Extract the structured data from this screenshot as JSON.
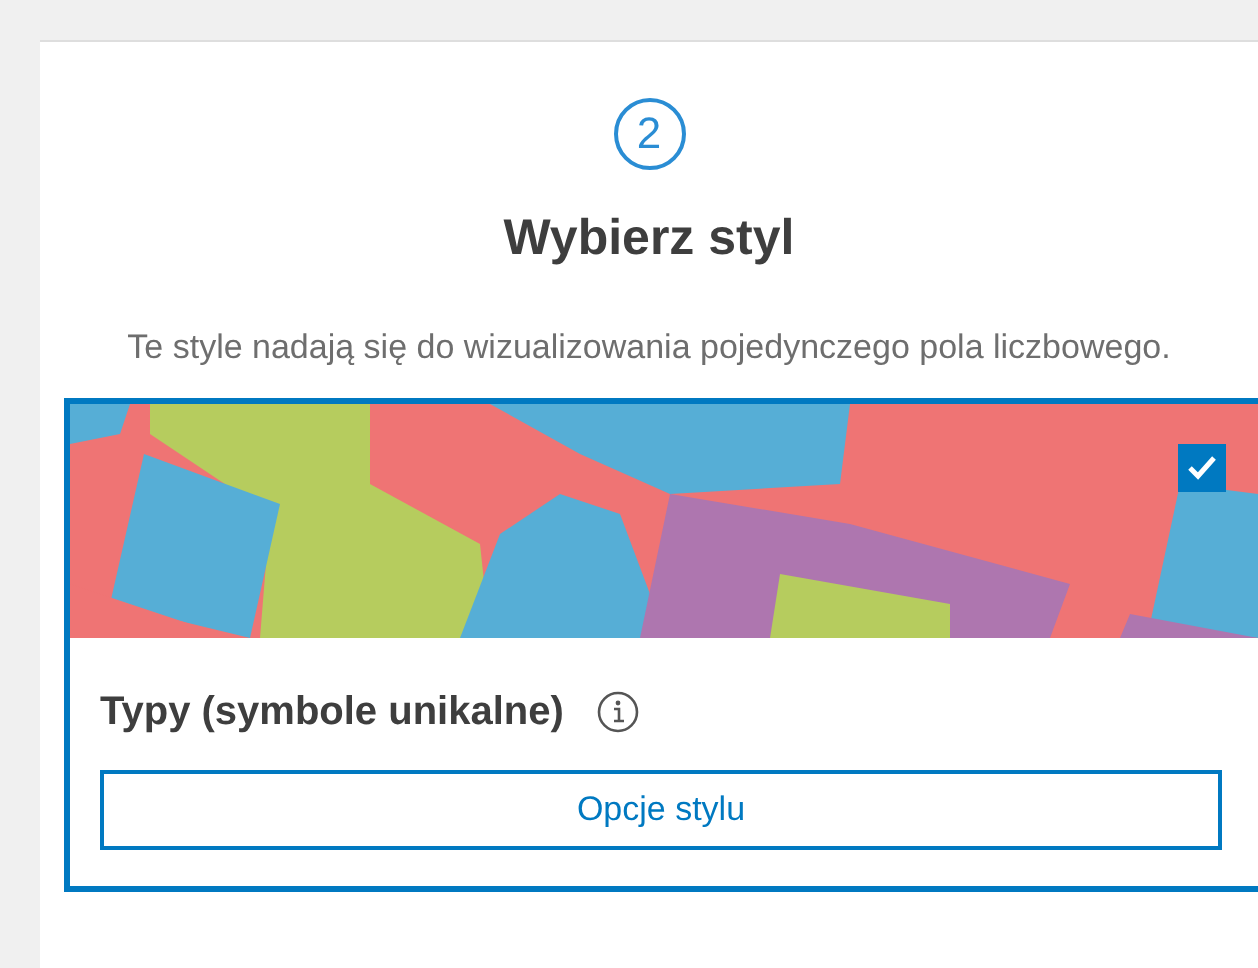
{
  "step": {
    "number": "2",
    "title": "Wybierz styl",
    "description": "Te style nadają się do wizualizowania pojedynczego pola liczbowego."
  },
  "style_cards": [
    {
      "title": "Typy (symbole unikalne)",
      "selected": true,
      "button": "Opcje stylu"
    }
  ]
}
